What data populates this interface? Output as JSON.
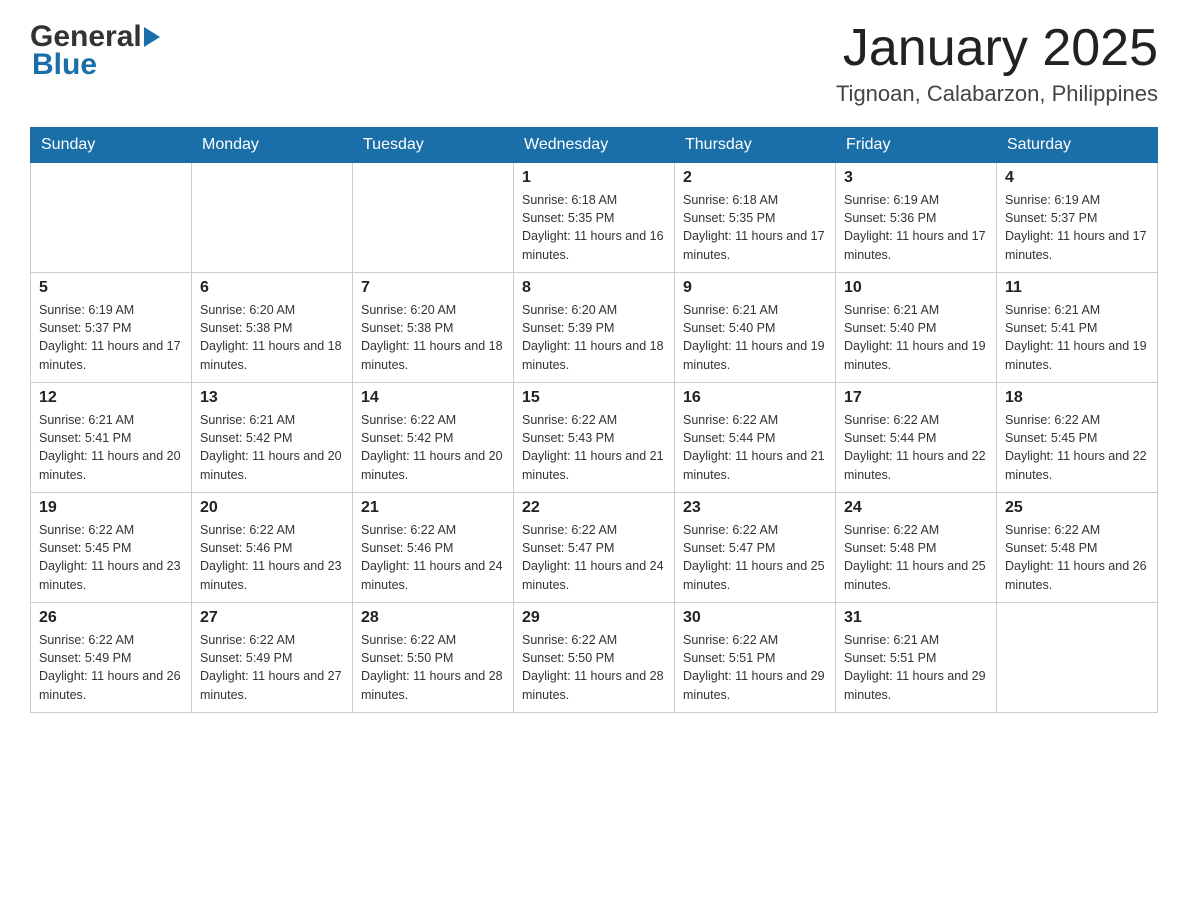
{
  "header": {
    "month_year": "January 2025",
    "location": "Tignoan, Calabarzon, Philippines",
    "logo": {
      "general": "General",
      "blue": "Blue"
    }
  },
  "days_of_week": [
    "Sunday",
    "Monday",
    "Tuesday",
    "Wednesday",
    "Thursday",
    "Friday",
    "Saturday"
  ],
  "weeks": [
    [
      {
        "day": "",
        "sunrise": "",
        "sunset": "",
        "daylight": ""
      },
      {
        "day": "",
        "sunrise": "",
        "sunset": "",
        "daylight": ""
      },
      {
        "day": "",
        "sunrise": "",
        "sunset": "",
        "daylight": ""
      },
      {
        "day": "1",
        "sunrise": "Sunrise: 6:18 AM",
        "sunset": "Sunset: 5:35 PM",
        "daylight": "Daylight: 11 hours and 16 minutes."
      },
      {
        "day": "2",
        "sunrise": "Sunrise: 6:18 AM",
        "sunset": "Sunset: 5:35 PM",
        "daylight": "Daylight: 11 hours and 17 minutes."
      },
      {
        "day": "3",
        "sunrise": "Sunrise: 6:19 AM",
        "sunset": "Sunset: 5:36 PM",
        "daylight": "Daylight: 11 hours and 17 minutes."
      },
      {
        "day": "4",
        "sunrise": "Sunrise: 6:19 AM",
        "sunset": "Sunset: 5:37 PM",
        "daylight": "Daylight: 11 hours and 17 minutes."
      }
    ],
    [
      {
        "day": "5",
        "sunrise": "Sunrise: 6:19 AM",
        "sunset": "Sunset: 5:37 PM",
        "daylight": "Daylight: 11 hours and 17 minutes."
      },
      {
        "day": "6",
        "sunrise": "Sunrise: 6:20 AM",
        "sunset": "Sunset: 5:38 PM",
        "daylight": "Daylight: 11 hours and 18 minutes."
      },
      {
        "day": "7",
        "sunrise": "Sunrise: 6:20 AM",
        "sunset": "Sunset: 5:38 PM",
        "daylight": "Daylight: 11 hours and 18 minutes."
      },
      {
        "day": "8",
        "sunrise": "Sunrise: 6:20 AM",
        "sunset": "Sunset: 5:39 PM",
        "daylight": "Daylight: 11 hours and 18 minutes."
      },
      {
        "day": "9",
        "sunrise": "Sunrise: 6:21 AM",
        "sunset": "Sunset: 5:40 PM",
        "daylight": "Daylight: 11 hours and 19 minutes."
      },
      {
        "day": "10",
        "sunrise": "Sunrise: 6:21 AM",
        "sunset": "Sunset: 5:40 PM",
        "daylight": "Daylight: 11 hours and 19 minutes."
      },
      {
        "day": "11",
        "sunrise": "Sunrise: 6:21 AM",
        "sunset": "Sunset: 5:41 PM",
        "daylight": "Daylight: 11 hours and 19 minutes."
      }
    ],
    [
      {
        "day": "12",
        "sunrise": "Sunrise: 6:21 AM",
        "sunset": "Sunset: 5:41 PM",
        "daylight": "Daylight: 11 hours and 20 minutes."
      },
      {
        "day": "13",
        "sunrise": "Sunrise: 6:21 AM",
        "sunset": "Sunset: 5:42 PM",
        "daylight": "Daylight: 11 hours and 20 minutes."
      },
      {
        "day": "14",
        "sunrise": "Sunrise: 6:22 AM",
        "sunset": "Sunset: 5:42 PM",
        "daylight": "Daylight: 11 hours and 20 minutes."
      },
      {
        "day": "15",
        "sunrise": "Sunrise: 6:22 AM",
        "sunset": "Sunset: 5:43 PM",
        "daylight": "Daylight: 11 hours and 21 minutes."
      },
      {
        "day": "16",
        "sunrise": "Sunrise: 6:22 AM",
        "sunset": "Sunset: 5:44 PM",
        "daylight": "Daylight: 11 hours and 21 minutes."
      },
      {
        "day": "17",
        "sunrise": "Sunrise: 6:22 AM",
        "sunset": "Sunset: 5:44 PM",
        "daylight": "Daylight: 11 hours and 22 minutes."
      },
      {
        "day": "18",
        "sunrise": "Sunrise: 6:22 AM",
        "sunset": "Sunset: 5:45 PM",
        "daylight": "Daylight: 11 hours and 22 minutes."
      }
    ],
    [
      {
        "day": "19",
        "sunrise": "Sunrise: 6:22 AM",
        "sunset": "Sunset: 5:45 PM",
        "daylight": "Daylight: 11 hours and 23 minutes."
      },
      {
        "day": "20",
        "sunrise": "Sunrise: 6:22 AM",
        "sunset": "Sunset: 5:46 PM",
        "daylight": "Daylight: 11 hours and 23 minutes."
      },
      {
        "day": "21",
        "sunrise": "Sunrise: 6:22 AM",
        "sunset": "Sunset: 5:46 PM",
        "daylight": "Daylight: 11 hours and 24 minutes."
      },
      {
        "day": "22",
        "sunrise": "Sunrise: 6:22 AM",
        "sunset": "Sunset: 5:47 PM",
        "daylight": "Daylight: 11 hours and 24 minutes."
      },
      {
        "day": "23",
        "sunrise": "Sunrise: 6:22 AM",
        "sunset": "Sunset: 5:47 PM",
        "daylight": "Daylight: 11 hours and 25 minutes."
      },
      {
        "day": "24",
        "sunrise": "Sunrise: 6:22 AM",
        "sunset": "Sunset: 5:48 PM",
        "daylight": "Daylight: 11 hours and 25 minutes."
      },
      {
        "day": "25",
        "sunrise": "Sunrise: 6:22 AM",
        "sunset": "Sunset: 5:48 PM",
        "daylight": "Daylight: 11 hours and 26 minutes."
      }
    ],
    [
      {
        "day": "26",
        "sunrise": "Sunrise: 6:22 AM",
        "sunset": "Sunset: 5:49 PM",
        "daylight": "Daylight: 11 hours and 26 minutes."
      },
      {
        "day": "27",
        "sunrise": "Sunrise: 6:22 AM",
        "sunset": "Sunset: 5:49 PM",
        "daylight": "Daylight: 11 hours and 27 minutes."
      },
      {
        "day": "28",
        "sunrise": "Sunrise: 6:22 AM",
        "sunset": "Sunset: 5:50 PM",
        "daylight": "Daylight: 11 hours and 28 minutes."
      },
      {
        "day": "29",
        "sunrise": "Sunrise: 6:22 AM",
        "sunset": "Sunset: 5:50 PM",
        "daylight": "Daylight: 11 hours and 28 minutes."
      },
      {
        "day": "30",
        "sunrise": "Sunrise: 6:22 AM",
        "sunset": "Sunset: 5:51 PM",
        "daylight": "Daylight: 11 hours and 29 minutes."
      },
      {
        "day": "31",
        "sunrise": "Sunrise: 6:21 AM",
        "sunset": "Sunset: 5:51 PM",
        "daylight": "Daylight: 11 hours and 29 minutes."
      },
      {
        "day": "",
        "sunrise": "",
        "sunset": "",
        "daylight": ""
      }
    ]
  ]
}
